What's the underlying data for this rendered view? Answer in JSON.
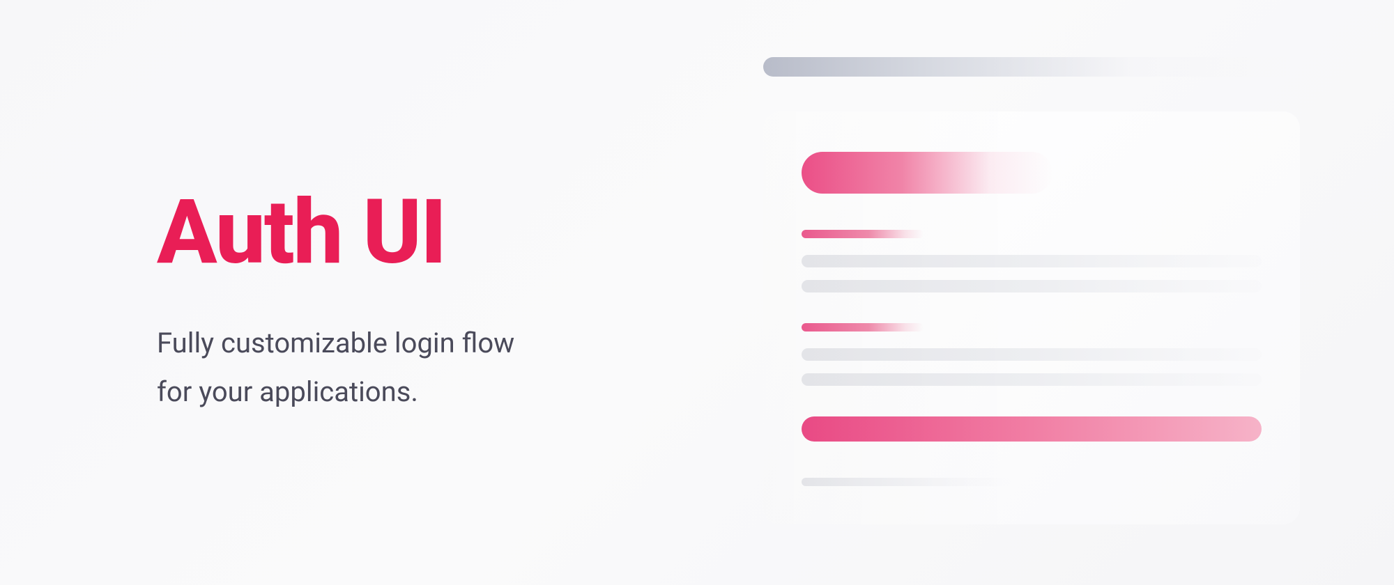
{
  "hero": {
    "title": "Auth UI",
    "subtitle_line1": "Fully customizable login flow",
    "subtitle_line2": "for your applications."
  }
}
